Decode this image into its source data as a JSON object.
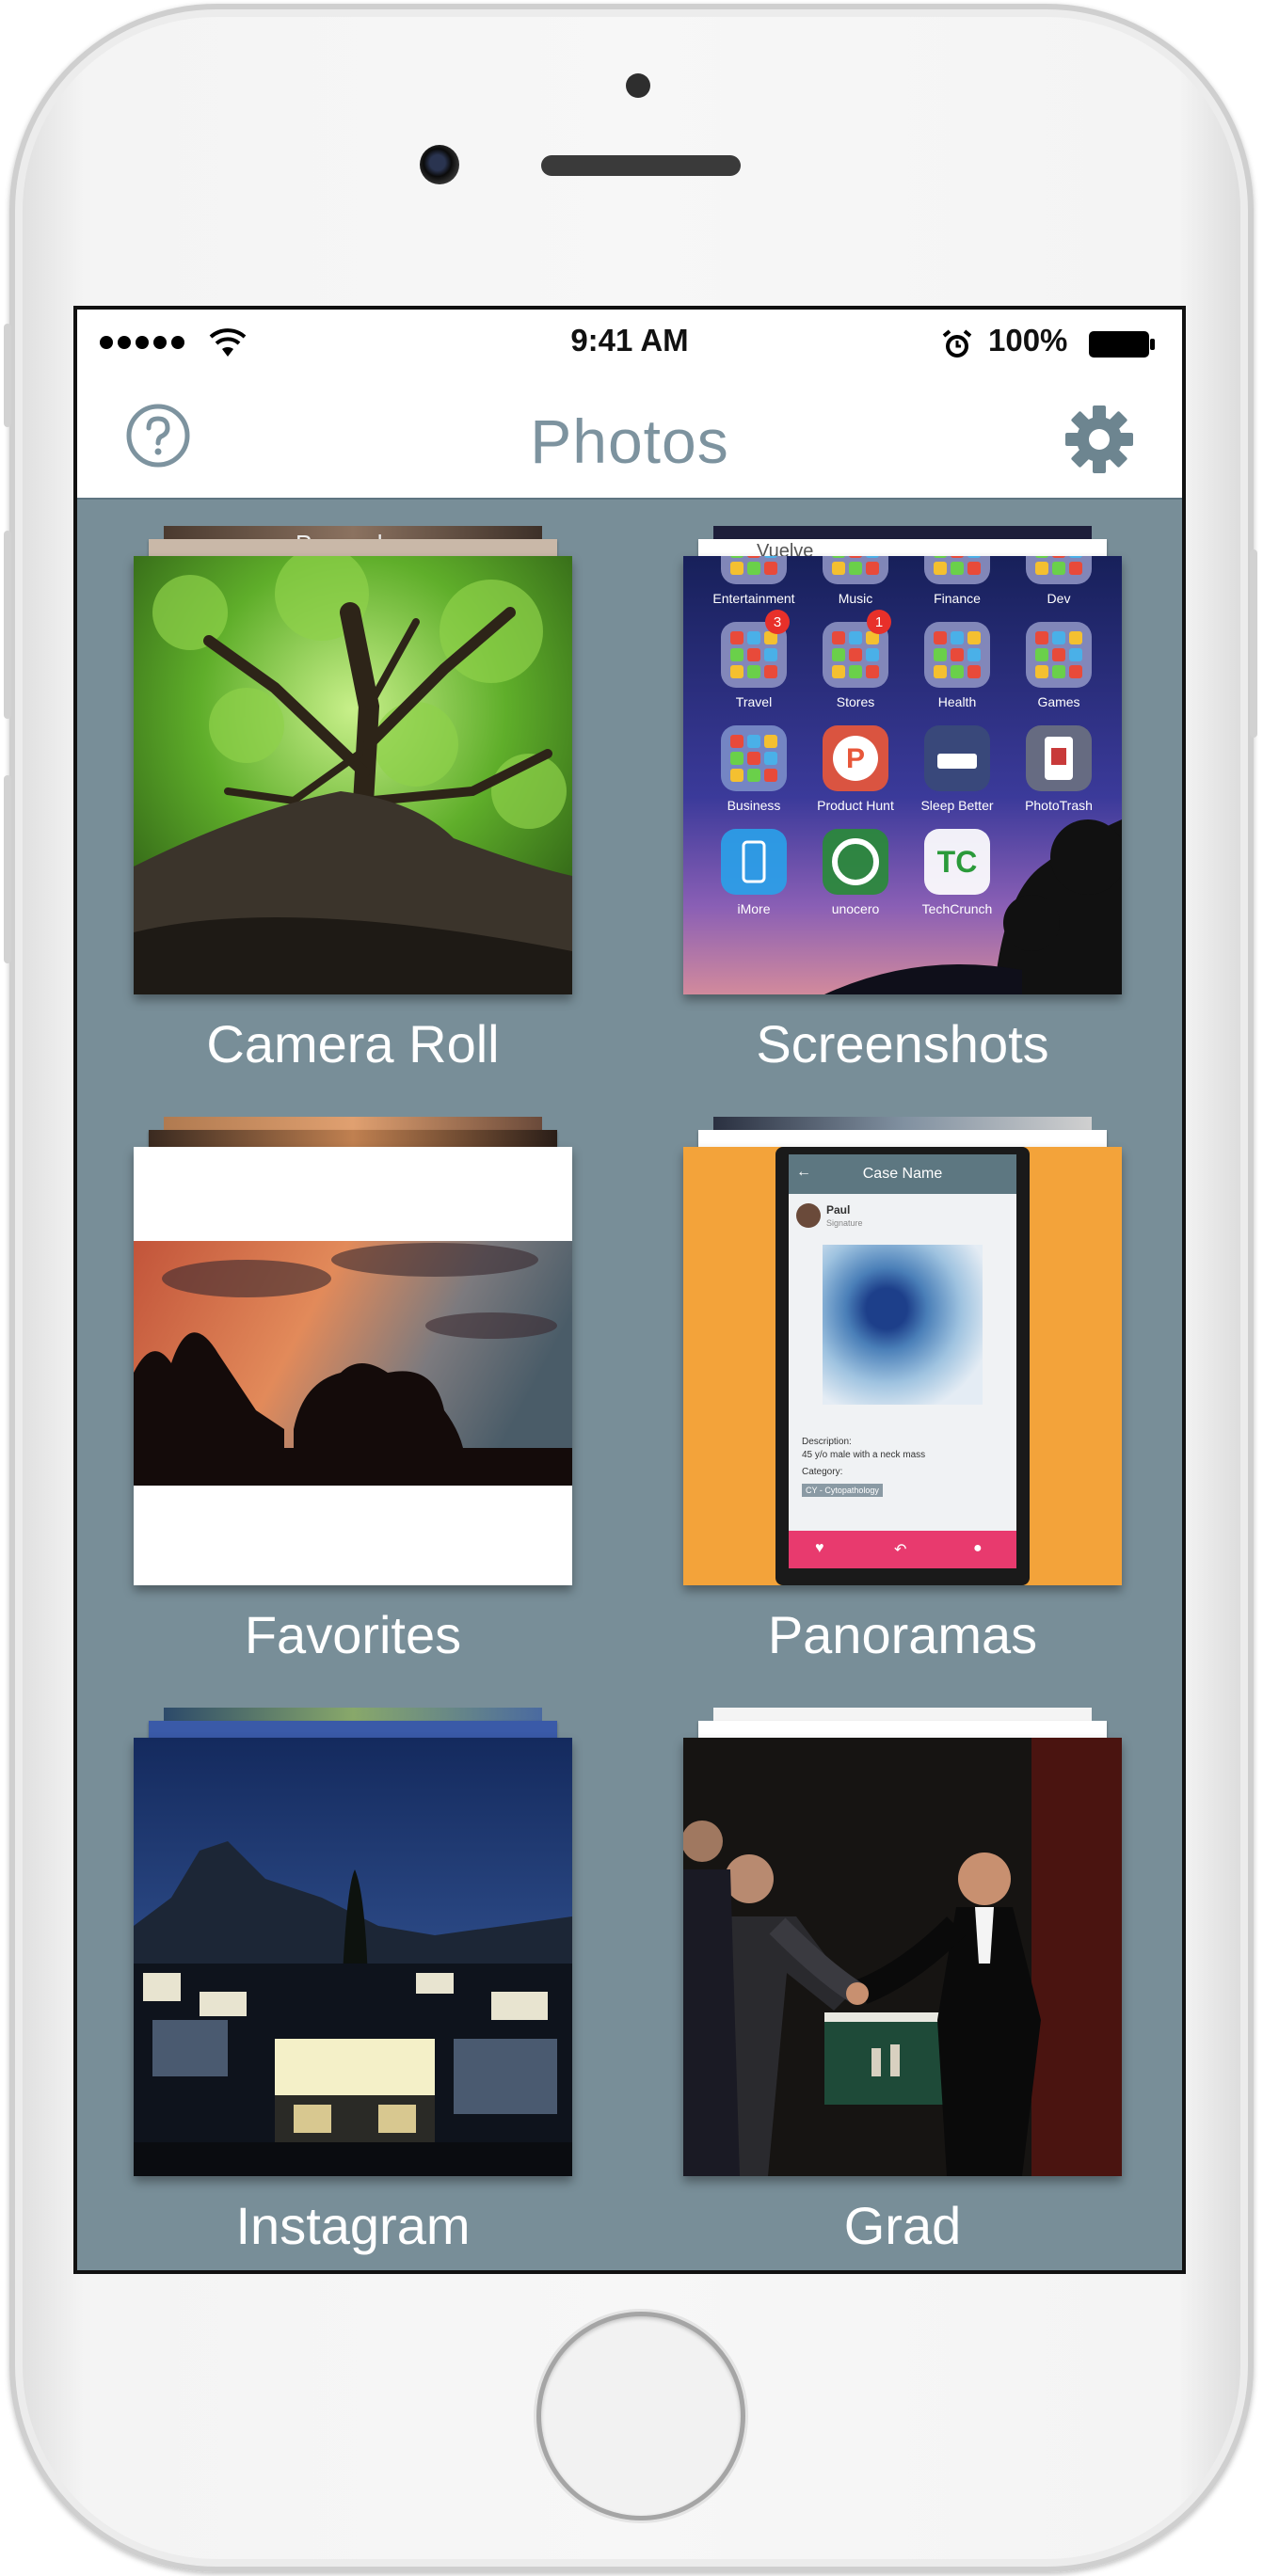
{
  "status_bar": {
    "time": "9:41 AM",
    "battery": "100%",
    "icons": [
      "signal-dots",
      "wifi-icon",
      "alarm-icon",
      "battery-icon"
    ]
  },
  "nav": {
    "title": "Photos",
    "left_icon": "help-icon",
    "right_icon": "gear-icon"
  },
  "albums": [
    {
      "name": "Camera Roll"
    },
    {
      "name": "Screenshots"
    },
    {
      "name": "Favorites"
    },
    {
      "name": "Panoramas"
    },
    {
      "name": "Instagram"
    },
    {
      "name": "Grad"
    }
  ],
  "thumb_text": {
    "camera_roll_peek": "Pascual",
    "screenshot_peek": "Vuelve",
    "folders": [
      "Entertainment",
      "Music",
      "Finance",
      "Dev",
      "Travel",
      "Stores",
      "Health",
      "Games"
    ],
    "apps": [
      "Business",
      "Product Hunt",
      "Sleep Better",
      "PhotoTrash",
      "iMore",
      "unocero",
      "TechCrunch"
    ],
    "badges": [
      "3",
      "1"
    ],
    "tc_logo": "TC",
    "case_title": "Case Name",
    "case_user": "Paul",
    "case_user_sub": "Signature",
    "case_description_label": "Description:",
    "case_description": "45 y/o male with a neck mass",
    "case_category_label": "Category:",
    "case_category": "CY - Cytopathology"
  },
  "colors": {
    "screen_bg": "#788e98",
    "accent": "#7d939f",
    "nav_bg": "#ffffff",
    "panorama_orange": "#f3a33a",
    "panorama_pink": "#e83a6e"
  }
}
